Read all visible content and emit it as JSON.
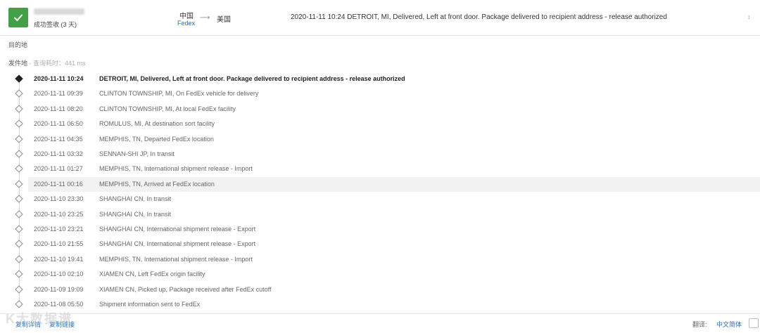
{
  "header": {
    "status": "成功签收 (3 天)",
    "origin": "中国",
    "carrier": "Fedex",
    "route_arrow": "⟶",
    "destination": "美国",
    "latest_event": "2020-11-11 10:24  DETROIT, MI, Delivered, Left at front door. Package delivered to recipient address - release authorized",
    "expand_icon": "↕",
    "colors": {
      "success": "#43a047",
      "link": "#2f6db5"
    }
  },
  "labels": {
    "destination": "目的地",
    "origin": "发件地",
    "query_meta": " - 查询耗时：441 ms"
  },
  "events": [
    {
      "time": "2020-11-11 10:24",
      "desc": "DETROIT, MI, Delivered, Left at front door. Package delivered to recipient address - release authorized"
    },
    {
      "time": "2020-11-11 09:39",
      "desc": "CLINTON TOWNSHIP, MI, On FedEx vehicle for delivery"
    },
    {
      "time": "2020-11-11 08:20",
      "desc": "CLINTON TOWNSHIP, MI, At local FedEx facility"
    },
    {
      "time": "2020-11-11 06:50",
      "desc": "ROMULUS, MI, At destination sort facility"
    },
    {
      "time": "2020-11-11 04:35",
      "desc": "MEMPHIS, TN, Departed FedEx location"
    },
    {
      "time": "2020-11-11 03:32",
      "desc": "SENNAN-SHI JP, In transit"
    },
    {
      "time": "2020-11-11 01:27",
      "desc": "MEMPHIS, TN, International shipment release - Import"
    },
    {
      "time": "2020-11-11 00:16",
      "desc": "MEMPHIS, TN, Arrived at FedEx location"
    },
    {
      "time": "2020-11-10 23:30",
      "desc": "SHANGHAI CN, In transit"
    },
    {
      "time": "2020-11-10 23:25",
      "desc": "SHANGHAI CN, In transit"
    },
    {
      "time": "2020-11-10 23:21",
      "desc": "SHANGHAI CN, International shipment release - Export"
    },
    {
      "time": "2020-11-10 21:55",
      "desc": "SHANGHAI CN, International shipment release - Export"
    },
    {
      "time": "2020-11-10 19:41",
      "desc": "MEMPHIS, TN, International shipment release - Import"
    },
    {
      "time": "2020-11-10 02:10",
      "desc": "XIAMEN CN, Left FedEx origin facility"
    },
    {
      "time": "2020-11-09 19:09",
      "desc": "XIAMEN CN, Picked up, Package received after FedEx cutoff"
    },
    {
      "time": "2020-11-08 05:50",
      "desc": "Shipment information sent to FedEx"
    }
  ],
  "footer": {
    "details_link": "复制详情",
    "copy_link": "复制链接",
    "translate_label": "翻译:",
    "language": "中文简体"
  },
  "watermark": "K大数据谱"
}
